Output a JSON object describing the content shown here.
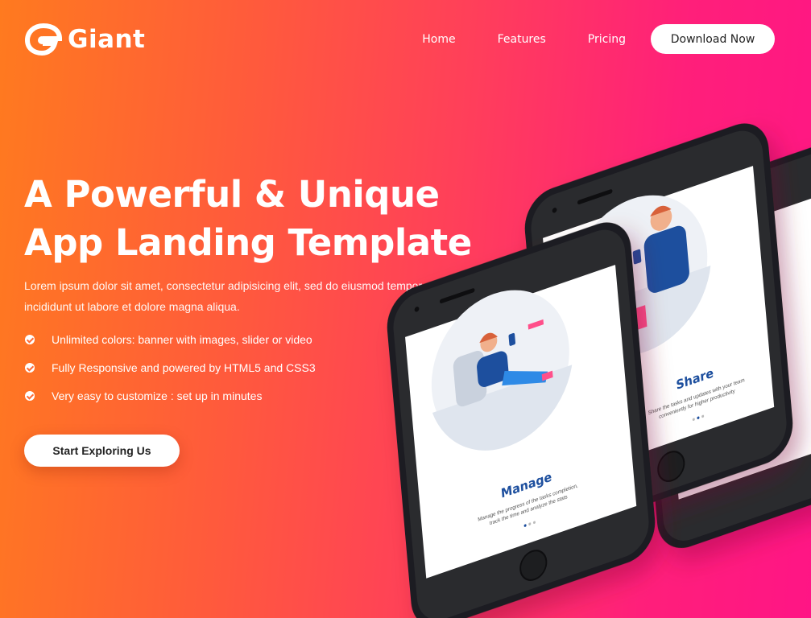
{
  "header": {
    "brand": "Giant",
    "nav": [
      {
        "label": "Home"
      },
      {
        "label": "Features"
      },
      {
        "label": "Pricing"
      }
    ],
    "download_label": "Download Now"
  },
  "hero": {
    "title_line1": "A Powerful & Unique",
    "title_line2": "App Landing Template",
    "description": "Lorem ipsum dolor sit amet, consectetur adipisicing elit, sed do eiusmod tempor incididunt ut labore et dolore magna aliqua.",
    "features": [
      {
        "text": "Unlimited colors: banner with images, slider or video"
      },
      {
        "text": "Fully Responsive and powered by HTML5 and CSS3"
      },
      {
        "text": "Very easy to customize : set up in minutes"
      }
    ],
    "cta_label": "Start Exploring Us"
  },
  "phones": {
    "front": {
      "title": "Manage",
      "text_line1": "Manage the progress of the tasks completion,",
      "text_line2": "track the time and analyze the stats"
    },
    "back": {
      "title": "Share",
      "text_line1": "Share the tasks and updates with your team",
      "text_line2": "conveniently for higher productivity"
    }
  },
  "colors": {
    "gradient_start": "#ff7a1f",
    "gradient_end": "#ff1585",
    "accent_blue": "#1d4f9e",
    "phone_body": "#1d1e20"
  }
}
